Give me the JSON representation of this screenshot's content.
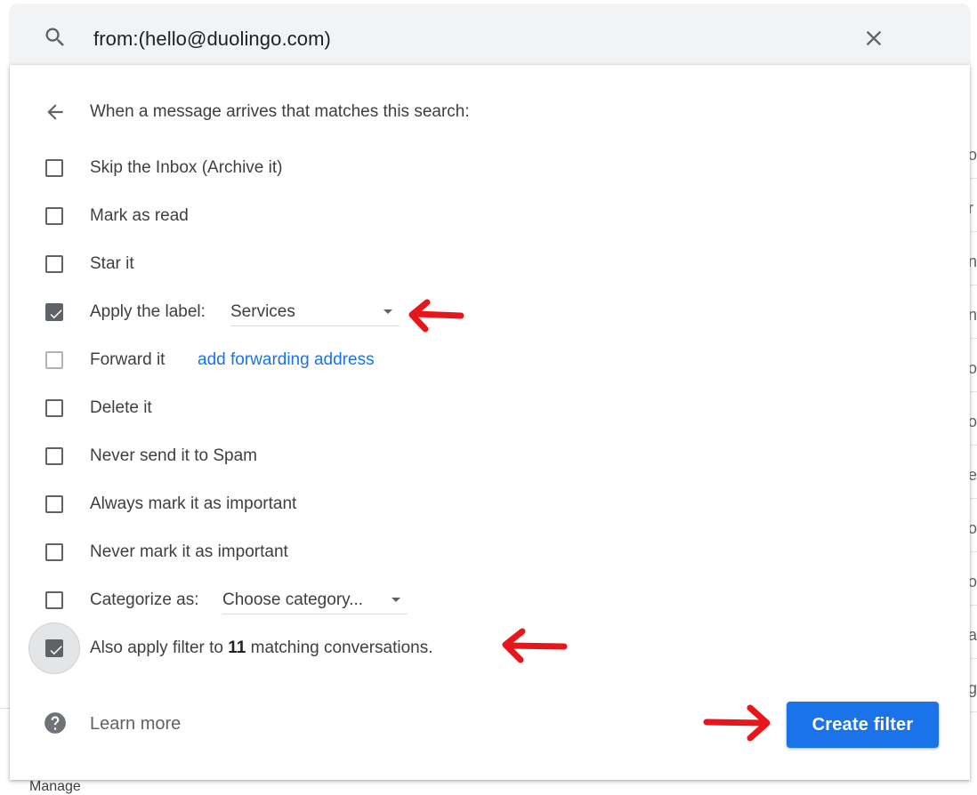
{
  "search": {
    "query": "from:(hello@duolingo.com)"
  },
  "header": {
    "text": "When a message arrives that matches this search:"
  },
  "options": {
    "skip_inbox": {
      "label": "Skip the Inbox (Archive it)",
      "checked": false
    },
    "mark_read": {
      "label": "Mark as read",
      "checked": false
    },
    "star": {
      "label": "Star it",
      "checked": false
    },
    "apply_label": {
      "label": "Apply the label:",
      "checked": true,
      "selected": "Services"
    },
    "forward": {
      "label": "Forward it",
      "link": "add forwarding address",
      "disabled": true
    },
    "delete": {
      "label": "Delete it",
      "checked": false
    },
    "never_spam": {
      "label": "Never send it to Spam",
      "checked": false
    },
    "always_important": {
      "label": "Always mark it as important",
      "checked": false
    },
    "never_important": {
      "label": "Never mark it as important",
      "checked": false
    },
    "categorize": {
      "label": "Categorize as:",
      "checked": false,
      "selected": "Choose category..."
    },
    "also_apply": {
      "prefix": "Also apply filter to ",
      "count": "11",
      "suffix": " matching conversations.",
      "checked": true
    }
  },
  "footer": {
    "learn_more": "Learn more",
    "create_button": "Create filter"
  },
  "background": {
    "manage": "Manage"
  },
  "colors": {
    "accent": "#1a73e8",
    "arrow": "#e8161b",
    "checkbox": "#5f6368"
  },
  "icons": [
    "search-icon",
    "close-icon",
    "back-arrow-icon",
    "check-icon",
    "caret-down-icon",
    "help-icon",
    "red-arrow-annotation"
  ]
}
